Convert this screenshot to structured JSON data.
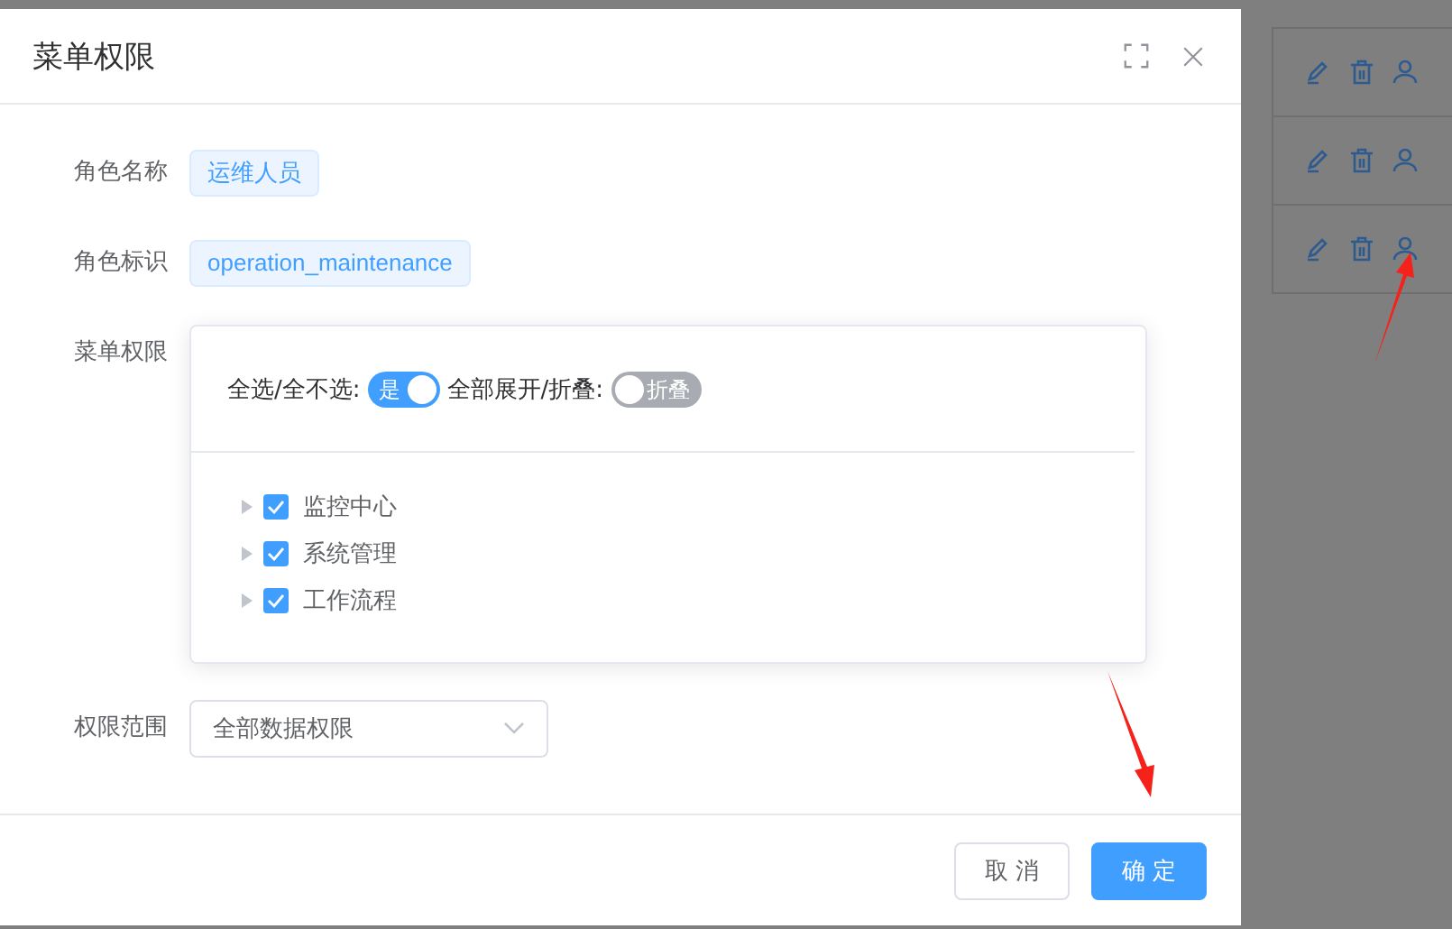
{
  "dialog": {
    "title": "菜单权限",
    "fields": [
      {
        "kind": "tag",
        "label": "角色名称",
        "value": "运维人员"
      },
      {
        "kind": "tag",
        "label": "角色标识",
        "value": "operation_maintenance"
      },
      {
        "kind": "tree",
        "label": "菜单权限",
        "switches": [
          {
            "label": "全选/全不选:",
            "text": "是",
            "on": true
          },
          {
            "label": "全部展开/折叠:",
            "text": "折叠",
            "on": false
          }
        ],
        "tree": [
          {
            "label": "监控中心",
            "checked": true,
            "expanded": false
          },
          {
            "label": "系统管理",
            "checked": true,
            "expanded": false
          },
          {
            "label": "工作流程",
            "checked": true,
            "expanded": false
          }
        ]
      },
      {
        "kind": "select",
        "label": "权限范围",
        "value": "全部数据权限"
      }
    ],
    "buttons": [
      {
        "label": "取 消",
        "kind": "default"
      },
      {
        "label": "确 定",
        "kind": "primary"
      }
    ]
  },
  "annotations": [
    {
      "kind": "arrow"
    },
    {
      "kind": "arrow"
    }
  ]
}
